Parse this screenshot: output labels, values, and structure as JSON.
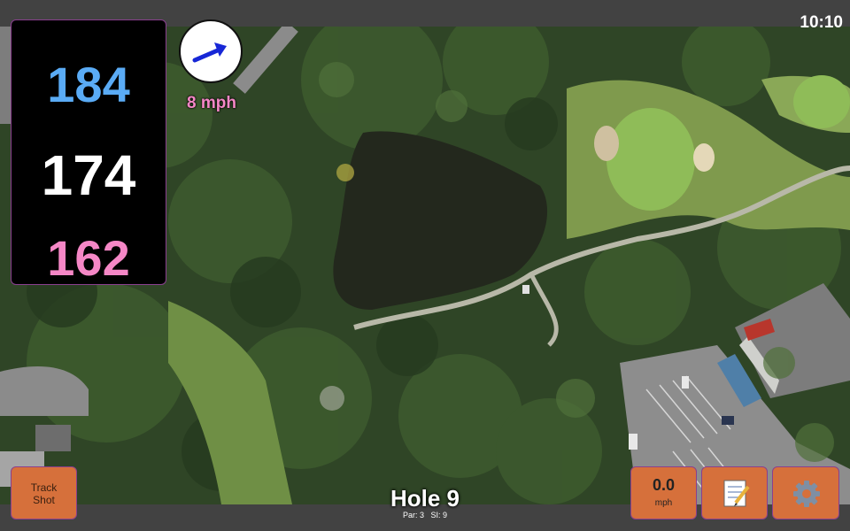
{
  "status_bar": {
    "time": "10:10"
  },
  "distances": {
    "back": "184",
    "middle": "174",
    "front": "162"
  },
  "wind": {
    "speed_label": "8 mph",
    "direction_icon": "arrow-icon"
  },
  "hole": {
    "title": "Hole 9",
    "par_label": "Par: 3",
    "si_label": "SI: 9"
  },
  "buttons": {
    "track_shot_line1": "Track",
    "track_shot_line2": "Shot",
    "speed_value": "0.0",
    "speed_unit": "mph",
    "notes_icon": "notepad-icon",
    "settings_icon": "gear-icon"
  },
  "colors": {
    "back_distance": "#5aabf5",
    "middle_distance": "#ffffff",
    "front_distance": "#f587c6",
    "button": "#d6703b",
    "accent_border": "#8a3f8f"
  }
}
